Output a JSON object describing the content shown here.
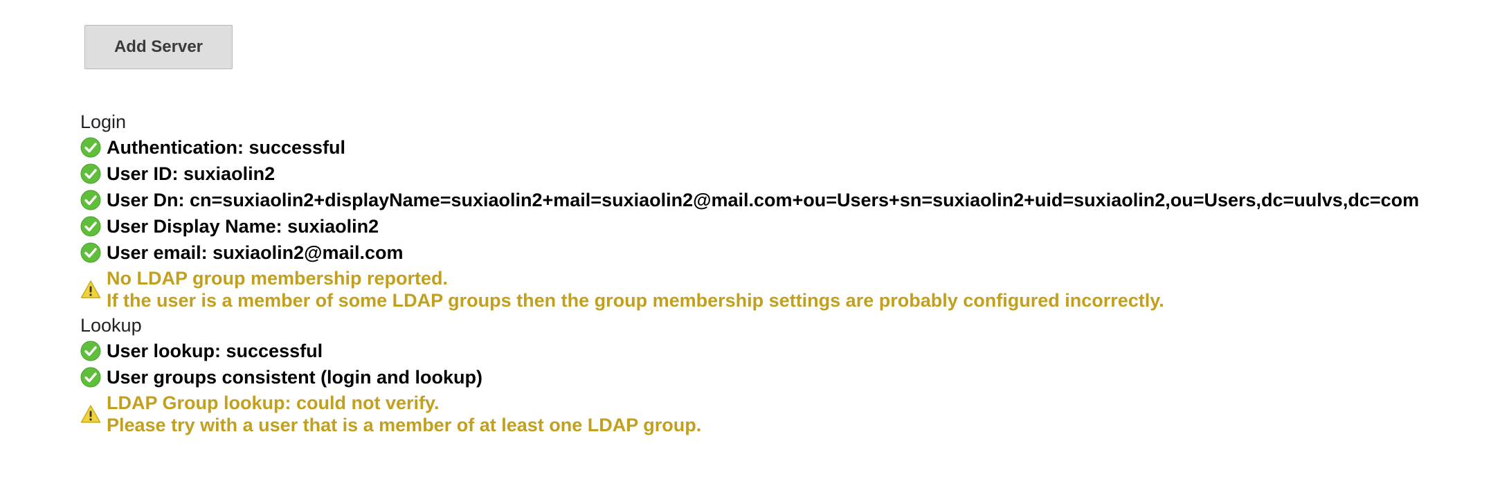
{
  "toolbar": {
    "add_server_label": "Add Server"
  },
  "colors": {
    "success": "#5fbf3a",
    "warning": "#c2a01e",
    "warning_icon": "#f0d23a"
  },
  "login": {
    "title": "Login",
    "items": [
      {
        "status": "success",
        "icon": "check-circle-icon",
        "text": "Authentication: successful"
      },
      {
        "status": "success",
        "icon": "check-circle-icon",
        "text": "User ID: suxiaolin2"
      },
      {
        "status": "success",
        "icon": "check-circle-icon",
        "text": "User Dn: cn=suxiaolin2+displayName=suxiaolin2+mail=suxiaolin2@mail.com+ou=Users+sn=suxiaolin2+uid=suxiaolin2,ou=Users,dc=uulvs,dc=com"
      },
      {
        "status": "success",
        "icon": "check-circle-icon",
        "text": "User Display Name: suxiaolin2"
      },
      {
        "status": "success",
        "icon": "check-circle-icon",
        "text": "User email: suxiaolin2@mail.com"
      }
    ],
    "warning": {
      "icon": "warning-triangle-icon",
      "line1": "No LDAP group membership reported.",
      "line2": "If the user is a member of some LDAP groups then the group membership settings are probably configured incorrectly."
    }
  },
  "lookup": {
    "title": "Lookup",
    "items": [
      {
        "status": "success",
        "icon": "check-circle-icon",
        "text": "User lookup: successful"
      },
      {
        "status": "success",
        "icon": "check-circle-icon",
        "text": "User groups consistent (login and lookup)"
      }
    ],
    "warning": {
      "icon": "warning-triangle-icon",
      "line1": "LDAP Group lookup: could not verify.",
      "line2": "Please try with a user that is a member of at least one LDAP group."
    }
  }
}
